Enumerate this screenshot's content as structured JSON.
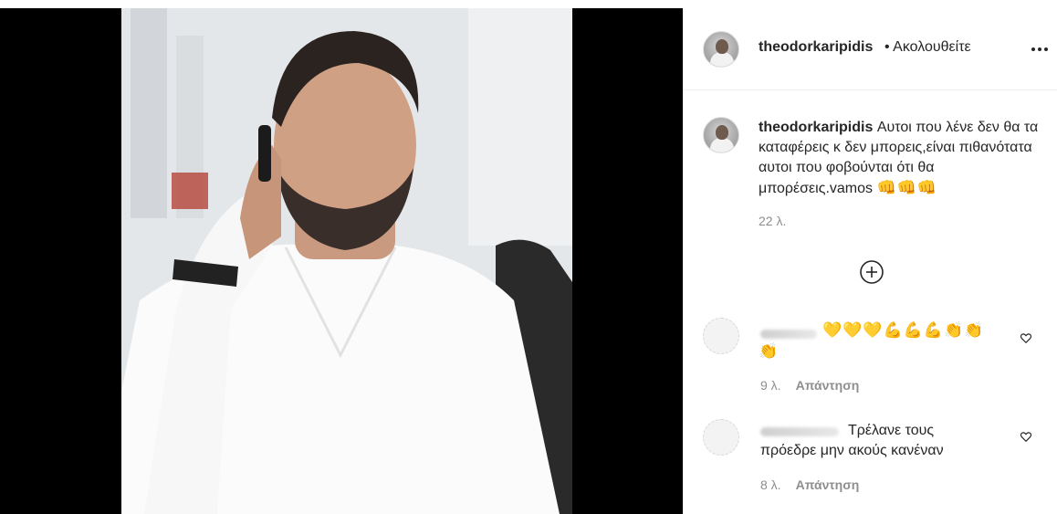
{
  "post": {
    "username": "theodorkaripidis",
    "follow_status": "• Ακολουθείτε",
    "more_icon": "more-horizontal-icon",
    "caption": {
      "username": "theodorkaripidis",
      "text": "Αυτοι που λένε δεν θα τα καταφέρεις κ δεν μπορεις,είναι πιθανότατα αυτοι που φοβούνται ότι θα μπορέσεις.vamos",
      "emoji": "👊👊👊",
      "time": "22 λ."
    },
    "load_more_icon": "plus-circle-icon"
  },
  "comments": [
    {
      "text": "",
      "emoji_line1": "💛💛💛💪💪💪👏👏",
      "emoji_line2": "👏",
      "time": "9 λ.",
      "reply_label": "Απάντηση"
    },
    {
      "text": "Τρέλανε τους",
      "text_line2": "πρόεδρε μην ακούς κανέναν",
      "time": "8 λ.",
      "reply_label": "Απάντηση"
    }
  ],
  "colors": {
    "text": "#262626",
    "muted": "#8e8e8e",
    "divider": "#efefef",
    "media_bg": "#000000"
  }
}
